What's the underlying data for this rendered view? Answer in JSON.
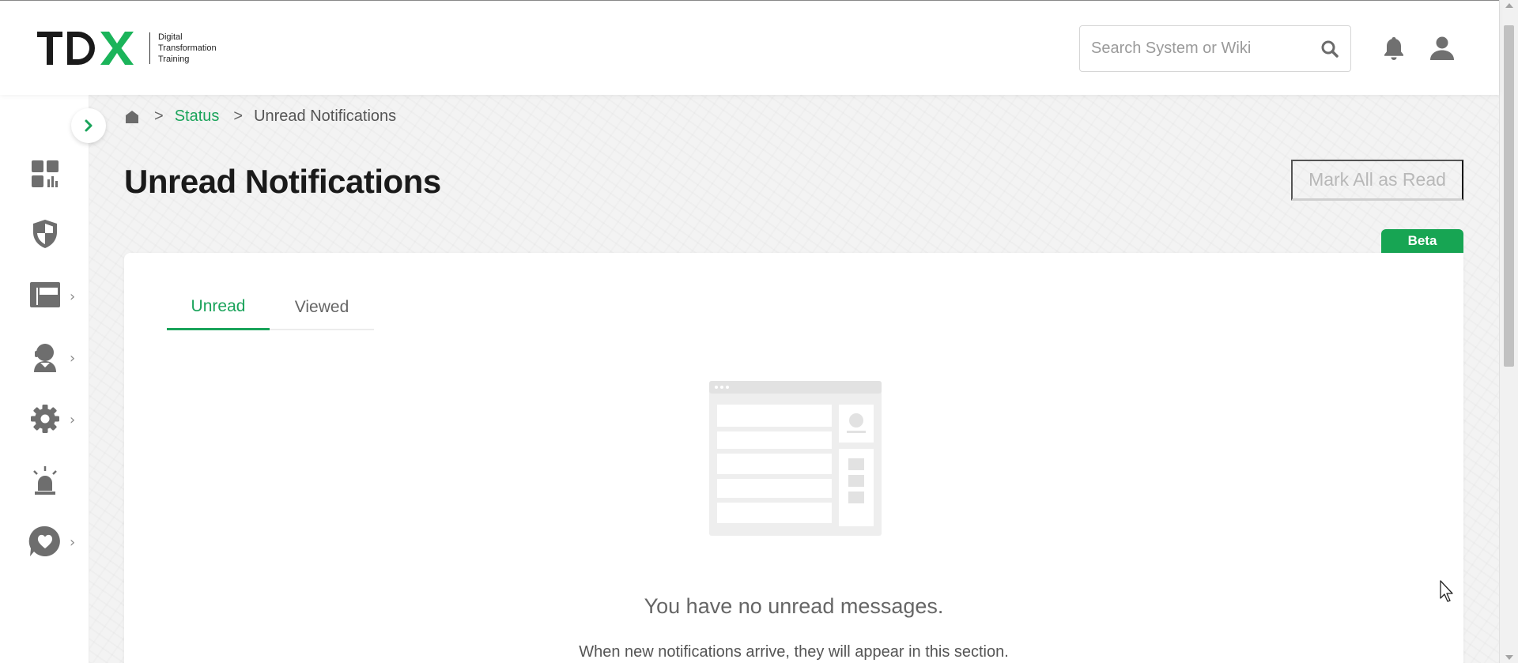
{
  "header": {
    "logo": {
      "mark": "TDX",
      "lines": [
        "Digital",
        "Transformation",
        "Training"
      ]
    },
    "search": {
      "placeholder": "Search System or Wiki",
      "value": ""
    },
    "icons": [
      "search-icon",
      "bell-icon",
      "user-icon"
    ]
  },
  "sidebar": {
    "items": [
      {
        "icon": "dashboard-icon",
        "has_submenu": false
      },
      {
        "icon": "shield-icon",
        "has_submenu": false
      },
      {
        "icon": "layout-icon",
        "has_submenu": true
      },
      {
        "icon": "support-agent-icon",
        "has_submenu": true
      },
      {
        "icon": "gear-icon",
        "has_submenu": true
      },
      {
        "icon": "alarm-siren-icon",
        "has_submenu": false
      },
      {
        "icon": "heart-chat-icon",
        "has_submenu": true
      }
    ],
    "chevron": "›"
  },
  "breadcrumb": {
    "separator": ">",
    "items": [
      "Status",
      "Unread Notifications"
    ]
  },
  "page": {
    "title": "Unread Notifications",
    "mark_all_label": "Mark All as Read",
    "beta_label": "Beta"
  },
  "tabs": [
    {
      "label": "Unread",
      "active": true
    },
    {
      "label": "Viewed",
      "active": false
    }
  ],
  "empty_state": {
    "title": "You have no unread messages.",
    "subtitle": "When new notifications arrive, they will appear in this section."
  },
  "colors": {
    "accent": "#19a35a",
    "beta_bg": "#17a553",
    "icon_gray": "#6e6e6e"
  }
}
